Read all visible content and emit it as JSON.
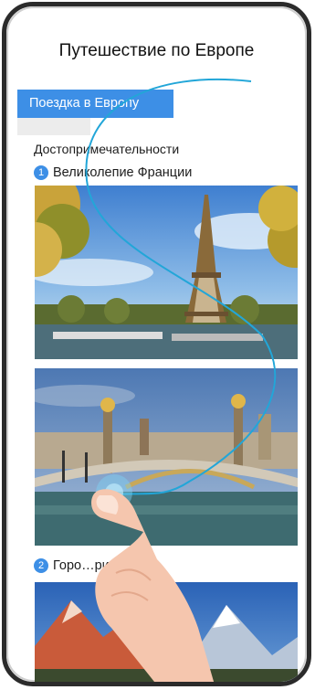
{
  "header": {
    "title": "Путешествие по Европе"
  },
  "trip_tab": {
    "label": "Поездка в Европу"
  },
  "content": {
    "section_heading": "Достопримечательности",
    "items": [
      {
        "number": "1",
        "title": "Великолепие Франции"
      },
      {
        "number": "2",
        "title": "Горо…рии"
      }
    ]
  },
  "colors": {
    "accent": "#3d8fe6",
    "gesture": "#22a6d8"
  }
}
